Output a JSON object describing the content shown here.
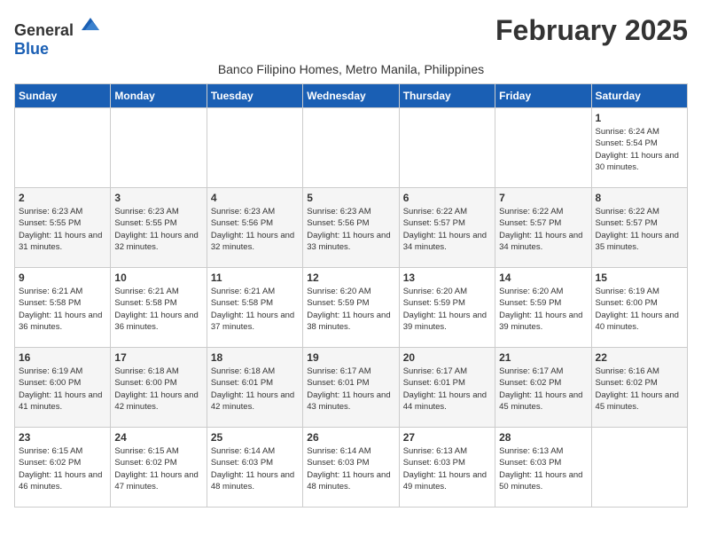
{
  "header": {
    "logo_general": "General",
    "logo_blue": "Blue",
    "month": "February 2025",
    "location": "Banco Filipino Homes, Metro Manila, Philippines"
  },
  "days_of_week": [
    "Sunday",
    "Monday",
    "Tuesday",
    "Wednesday",
    "Thursday",
    "Friday",
    "Saturday"
  ],
  "weeks": [
    [
      {
        "day": "",
        "info": ""
      },
      {
        "day": "",
        "info": ""
      },
      {
        "day": "",
        "info": ""
      },
      {
        "day": "",
        "info": ""
      },
      {
        "day": "",
        "info": ""
      },
      {
        "day": "",
        "info": ""
      },
      {
        "day": "1",
        "info": "Sunrise: 6:24 AM\nSunset: 5:54 PM\nDaylight: 11 hours and 30 minutes."
      }
    ],
    [
      {
        "day": "2",
        "info": "Sunrise: 6:23 AM\nSunset: 5:55 PM\nDaylight: 11 hours and 31 minutes."
      },
      {
        "day": "3",
        "info": "Sunrise: 6:23 AM\nSunset: 5:55 PM\nDaylight: 11 hours and 32 minutes."
      },
      {
        "day": "4",
        "info": "Sunrise: 6:23 AM\nSunset: 5:56 PM\nDaylight: 11 hours and 32 minutes."
      },
      {
        "day": "5",
        "info": "Sunrise: 6:23 AM\nSunset: 5:56 PM\nDaylight: 11 hours and 33 minutes."
      },
      {
        "day": "6",
        "info": "Sunrise: 6:22 AM\nSunset: 5:57 PM\nDaylight: 11 hours and 34 minutes."
      },
      {
        "day": "7",
        "info": "Sunrise: 6:22 AM\nSunset: 5:57 PM\nDaylight: 11 hours and 34 minutes."
      },
      {
        "day": "8",
        "info": "Sunrise: 6:22 AM\nSunset: 5:57 PM\nDaylight: 11 hours and 35 minutes."
      }
    ],
    [
      {
        "day": "9",
        "info": "Sunrise: 6:21 AM\nSunset: 5:58 PM\nDaylight: 11 hours and 36 minutes."
      },
      {
        "day": "10",
        "info": "Sunrise: 6:21 AM\nSunset: 5:58 PM\nDaylight: 11 hours and 36 minutes."
      },
      {
        "day": "11",
        "info": "Sunrise: 6:21 AM\nSunset: 5:58 PM\nDaylight: 11 hours and 37 minutes."
      },
      {
        "day": "12",
        "info": "Sunrise: 6:20 AM\nSunset: 5:59 PM\nDaylight: 11 hours and 38 minutes."
      },
      {
        "day": "13",
        "info": "Sunrise: 6:20 AM\nSunset: 5:59 PM\nDaylight: 11 hours and 39 minutes."
      },
      {
        "day": "14",
        "info": "Sunrise: 6:20 AM\nSunset: 5:59 PM\nDaylight: 11 hours and 39 minutes."
      },
      {
        "day": "15",
        "info": "Sunrise: 6:19 AM\nSunset: 6:00 PM\nDaylight: 11 hours and 40 minutes."
      }
    ],
    [
      {
        "day": "16",
        "info": "Sunrise: 6:19 AM\nSunset: 6:00 PM\nDaylight: 11 hours and 41 minutes."
      },
      {
        "day": "17",
        "info": "Sunrise: 6:18 AM\nSunset: 6:00 PM\nDaylight: 11 hours and 42 minutes."
      },
      {
        "day": "18",
        "info": "Sunrise: 6:18 AM\nSunset: 6:01 PM\nDaylight: 11 hours and 42 minutes."
      },
      {
        "day": "19",
        "info": "Sunrise: 6:17 AM\nSunset: 6:01 PM\nDaylight: 11 hours and 43 minutes."
      },
      {
        "day": "20",
        "info": "Sunrise: 6:17 AM\nSunset: 6:01 PM\nDaylight: 11 hours and 44 minutes."
      },
      {
        "day": "21",
        "info": "Sunrise: 6:17 AM\nSunset: 6:02 PM\nDaylight: 11 hours and 45 minutes."
      },
      {
        "day": "22",
        "info": "Sunrise: 6:16 AM\nSunset: 6:02 PM\nDaylight: 11 hours and 45 minutes."
      }
    ],
    [
      {
        "day": "23",
        "info": "Sunrise: 6:15 AM\nSunset: 6:02 PM\nDaylight: 11 hours and 46 minutes."
      },
      {
        "day": "24",
        "info": "Sunrise: 6:15 AM\nSunset: 6:02 PM\nDaylight: 11 hours and 47 minutes."
      },
      {
        "day": "25",
        "info": "Sunrise: 6:14 AM\nSunset: 6:03 PM\nDaylight: 11 hours and 48 minutes."
      },
      {
        "day": "26",
        "info": "Sunrise: 6:14 AM\nSunset: 6:03 PM\nDaylight: 11 hours and 48 minutes."
      },
      {
        "day": "27",
        "info": "Sunrise: 6:13 AM\nSunset: 6:03 PM\nDaylight: 11 hours and 49 minutes."
      },
      {
        "day": "28",
        "info": "Sunrise: 6:13 AM\nSunset: 6:03 PM\nDaylight: 11 hours and 50 minutes."
      },
      {
        "day": "",
        "info": ""
      }
    ]
  ]
}
